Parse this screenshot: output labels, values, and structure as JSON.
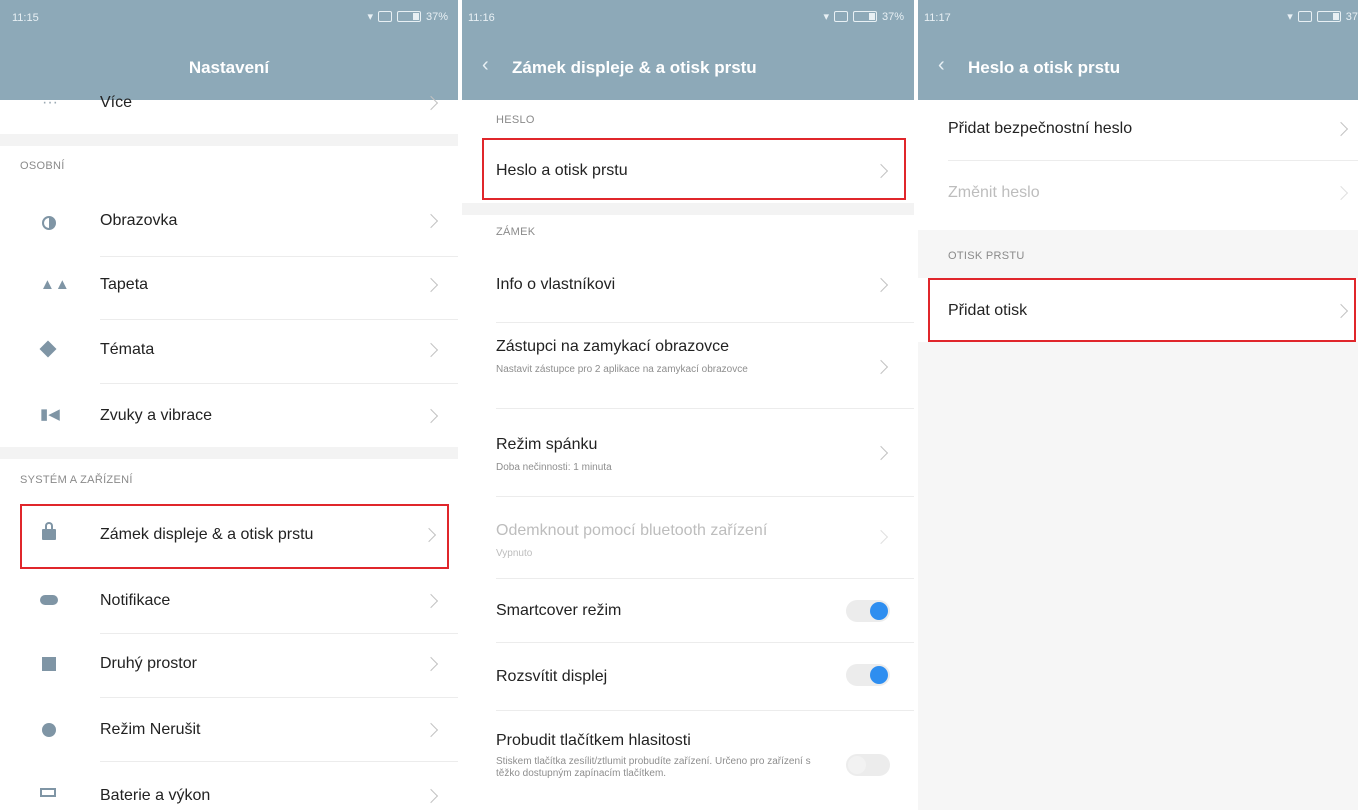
{
  "screen1": {
    "time": "11:15",
    "battery": "37%",
    "title": "Nastavení",
    "more_label": "Více",
    "section_personal": "OSOBNÍ",
    "personal_items": [
      "Obrazovka",
      "Tapeta",
      "Témata",
      "Zvuky a vibrace"
    ],
    "section_system": "SYSTÉM A ZAŘÍZENÍ",
    "system_items": [
      "Zámek displeje & a otisk prstu",
      "Notifikace",
      "Druhý prostor",
      "Režim Nerušit",
      "Baterie a výkon"
    ]
  },
  "screen2": {
    "time": "11:16",
    "battery": "37%",
    "title": "Zámek displeje & a otisk prstu",
    "section_password": "HESLO",
    "password_item": "Heslo a otisk prstu",
    "section_lock": "ZÁMEK",
    "owner_info": "Info o vlastníkovi",
    "shortcuts_title": "Zástupci na zamykací obrazovce",
    "shortcuts_sub": "Nastavit zástupce pro 2 aplikace na zamykací obrazovce",
    "sleep_title": "Režim spánku",
    "sleep_sub": "Doba nečinnosti: 1 minuta",
    "bt_title": "Odemknout pomocí bluetooth zařízení",
    "bt_sub": "Vypnuto",
    "smartcover": "Smartcover režim",
    "wake_display": "Rozsvítit displej",
    "volume_wake_title": "Probudit tlačítkem hlasitosti",
    "volume_wake_sub": "Stiskem tlačítka zesílit/ztlumit probudíte zařízení. Určeno pro zařízení s těžko dostupným zapínacím tlačítkem."
  },
  "screen3": {
    "time": "11:17",
    "battery": "37",
    "title": "Heslo a otisk prstu",
    "add_password": "Přidat bezpečnostní heslo",
    "change_password": "Změnit heslo",
    "section_fingerprint": "OTISK PRSTU",
    "add_fingerprint": "Přidat otisk"
  },
  "colors": {
    "header": "#8da9b8",
    "highlight_border": "#e0262b",
    "toggle_on": "#2e8ef0"
  }
}
